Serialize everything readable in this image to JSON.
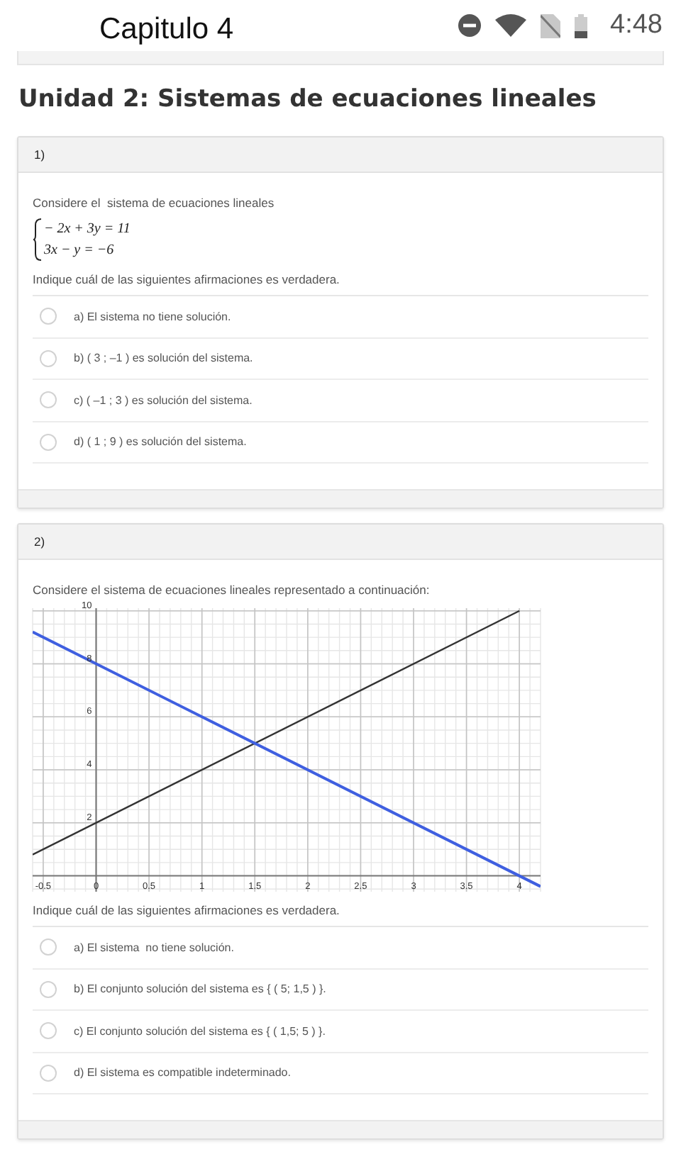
{
  "status_bar": {
    "title": "Capitulo 4",
    "time": "4:48"
  },
  "heading": "Unidad 2: Sistemas de ecuaciones lineales",
  "questions": [
    {
      "number": "1)",
      "prompt": "Considere el  sistema de ecuaciones lineales",
      "equations": [
        "− 2x + 3y = 11",
        "3x − y = −6"
      ],
      "instruction": "Indique cuál de las siguientes afirmaciones es verdadera.",
      "options": [
        {
          "label": "a) El sistema no tiene solución.",
          "selected": false
        },
        {
          "label": "b) ( 3 ; –1 ) es solución del sistema.",
          "selected": false
        },
        {
          "label": "c) ( –1 ; 3 ) es solución del sistema.",
          "selected": false
        },
        {
          "label": "d) ( 1 ; 9 ) es solución del sistema.",
          "selected": false
        }
      ]
    },
    {
      "number": "2)",
      "prompt": "Considere el sistema de ecuaciones lineales representado a continuación:",
      "chart_data": {
        "type": "line",
        "grid": true,
        "x": [
          -0.6,
          4,
          4.2
        ],
        "series": [
          {
            "color": "#333333",
            "values": [
              0.8,
              10,
              null
            ]
          },
          {
            "color": "#3f5fe0",
            "values": [
              9.2,
              0,
              -0.4
            ]
          }
        ],
        "xlim": [
          -0.6,
          4.2
        ],
        "ylim": [
          -0.6,
          10.1
        ],
        "xticks": [
          -0.5,
          0,
          0.5,
          1,
          1.5,
          2,
          2.5,
          3,
          3.5,
          4
        ],
        "yticks": [
          2,
          4,
          6,
          8,
          10
        ]
      },
      "instruction": "Indique cuál de las siguientes afirmaciones es verdadera.",
      "options": [
        {
          "label": "a) El sistema  no tiene solución.",
          "selected": false
        },
        {
          "label": "b) El conjunto solución del sistema es { ( 5; 1,5 ) }.",
          "selected": false
        },
        {
          "label": "c) El conjunto solución del sistema es { ( 1,5; 5 ) }.",
          "selected": false
        },
        {
          "label": "d) El sistema es compatible indeterminado.",
          "selected": false
        }
      ]
    }
  ]
}
